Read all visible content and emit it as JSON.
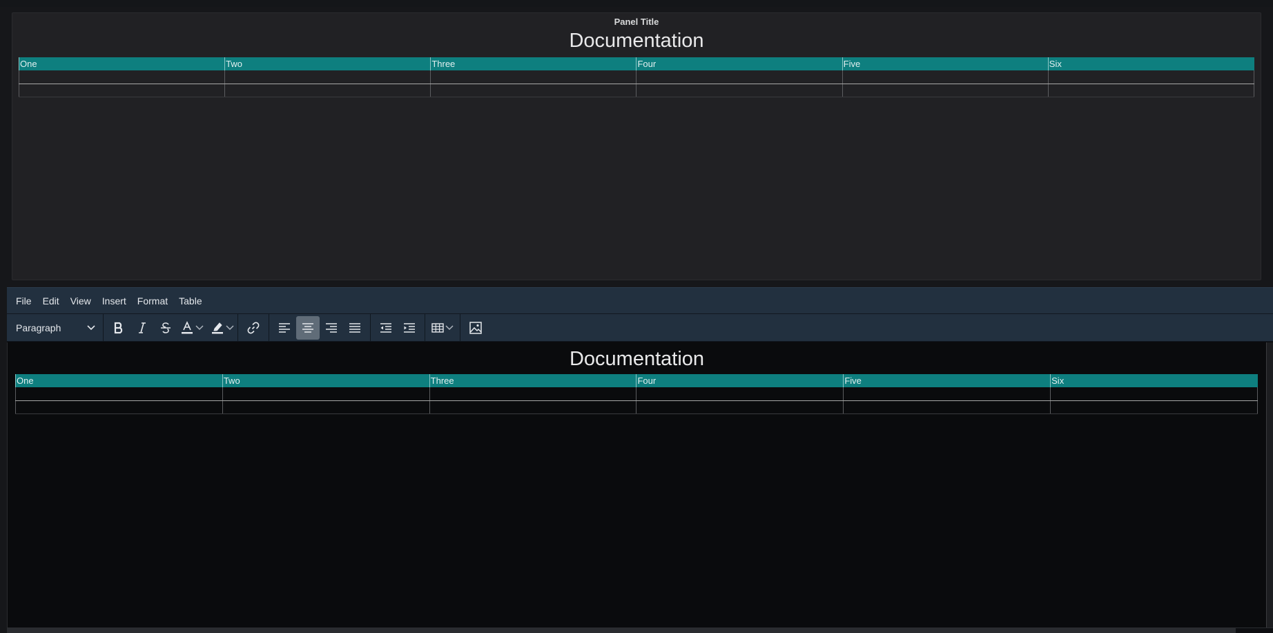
{
  "preview": {
    "panel_title": "Panel Title",
    "heading": "Documentation",
    "table": {
      "headers": [
        "One",
        "Two",
        "Three",
        "Four",
        "Five",
        "Six"
      ],
      "rows": [
        [
          "",
          "",
          "",
          "",
          "",
          ""
        ],
        [
          "",
          "",
          "",
          "",
          "",
          ""
        ]
      ]
    }
  },
  "editor": {
    "menu": [
      "File",
      "Edit",
      "View",
      "Insert",
      "Format",
      "Table"
    ],
    "toolbar": {
      "block_format": "Paragraph",
      "buttons": [
        "bold-icon",
        "italic-icon",
        "strikethrough-icon",
        "text-color-icon",
        "highlight-icon",
        "link-icon",
        "align-left-icon",
        "align-center-icon",
        "align-right-icon",
        "align-justify-icon",
        "outdent-icon",
        "indent-icon",
        "table-icon",
        "image-icon"
      ],
      "active": "align-center-icon"
    },
    "content": {
      "heading": "Documentation",
      "table": {
        "headers": [
          "One",
          "Two",
          "Three",
          "Four",
          "Five",
          "Six"
        ],
        "rows": [
          [
            "",
            "",
            "",
            "",
            "",
            ""
          ],
          [
            "",
            "",
            "",
            "",
            "",
            ""
          ]
        ]
      }
    }
  },
  "colors": {
    "table_header": "#0e7f7f",
    "toolbar_bg": "#22303f",
    "panel_bg": "#212124",
    "editor_bg": "#0a0b0d"
  }
}
